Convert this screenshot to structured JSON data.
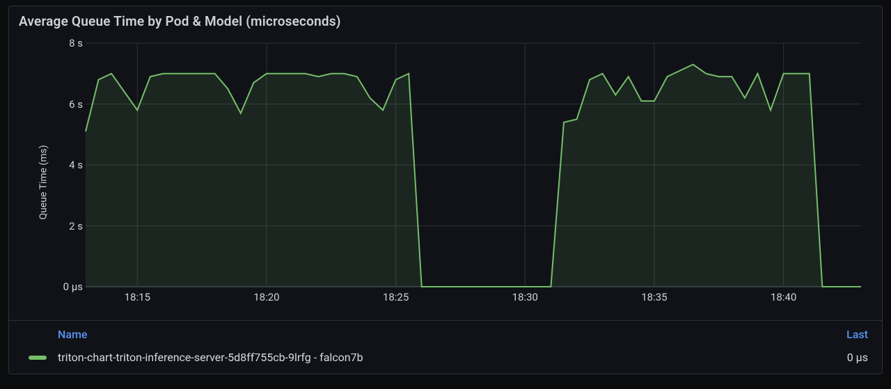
{
  "panel": {
    "title": "Average Queue Time by Pod & Model (microseconds)"
  },
  "legend": {
    "header_name": "Name",
    "header_last": "Last",
    "rows": [
      {
        "swatch_color": "#73bf69",
        "name": "triton-chart-triton-inference-server-5d8ff755cb-9lrfg - falcon7b",
        "last": "0 µs"
      }
    ]
  },
  "chart_data": {
    "type": "line",
    "title": "Average Queue Time by Pod & Model (microseconds)",
    "xlabel": "",
    "ylabel": "Queue Time (ms)",
    "ylim": [
      0,
      8
    ],
    "x_range_minutes": [
      13.0,
      43.0
    ],
    "y_ticks": [
      {
        "value": 0,
        "label": "0 µs"
      },
      {
        "value": 2,
        "label": "2 s"
      },
      {
        "value": 4,
        "label": "4 s"
      },
      {
        "value": 6,
        "label": "6 s"
      },
      {
        "value": 8,
        "label": "8 s"
      }
    ],
    "x_ticks": [
      {
        "value": 15,
        "label": "18:15"
      },
      {
        "value": 20,
        "label": "18:20"
      },
      {
        "value": 25,
        "label": "18:25"
      },
      {
        "value": 30,
        "label": "18:30"
      },
      {
        "value": 35,
        "label": "18:35"
      },
      {
        "value": 40,
        "label": "18:40"
      }
    ],
    "series": [
      {
        "name": "triton-chart-triton-inference-server-5d8ff755cb-9lrfg - falcon7b",
        "color": "#73bf69",
        "x": [
          13.0,
          13.5,
          14.0,
          14.5,
          15.0,
          15.5,
          16.0,
          16.5,
          17.0,
          17.5,
          18.0,
          18.5,
          19.0,
          19.5,
          20.0,
          20.5,
          21.0,
          21.5,
          22.0,
          22.5,
          23.0,
          23.5,
          24.0,
          24.5,
          25.0,
          25.5,
          26.0,
          26.5,
          27.0,
          27.5,
          28.0,
          28.5,
          29.0,
          29.5,
          30.0,
          30.5,
          31.0,
          31.5,
          32.0,
          32.5,
          33.0,
          33.5,
          34.0,
          34.5,
          35.0,
          35.5,
          36.0,
          36.5,
          37.0,
          37.5,
          38.0,
          38.5,
          39.0,
          39.5,
          40.0,
          40.5,
          41.0,
          41.5,
          42.0,
          42.5,
          43.0
        ],
        "y": [
          5.1,
          6.8,
          7.0,
          6.4,
          5.8,
          6.9,
          7.0,
          7.0,
          7.0,
          7.0,
          7.0,
          6.5,
          5.7,
          6.7,
          7.0,
          7.0,
          7.0,
          7.0,
          6.9,
          7.0,
          7.0,
          6.9,
          6.2,
          5.8,
          6.8,
          7.0,
          0.0,
          0.0,
          0.0,
          0.0,
          0.0,
          0.0,
          0.0,
          0.0,
          0.0,
          0.0,
          0.0,
          5.4,
          5.5,
          6.8,
          7.0,
          6.3,
          6.9,
          6.1,
          6.1,
          6.9,
          7.1,
          7.3,
          7.0,
          6.9,
          6.9,
          6.2,
          7.0,
          5.8,
          7.0,
          7.0,
          7.0,
          0.0,
          0.0,
          0.0,
          0.0
        ]
      }
    ]
  }
}
